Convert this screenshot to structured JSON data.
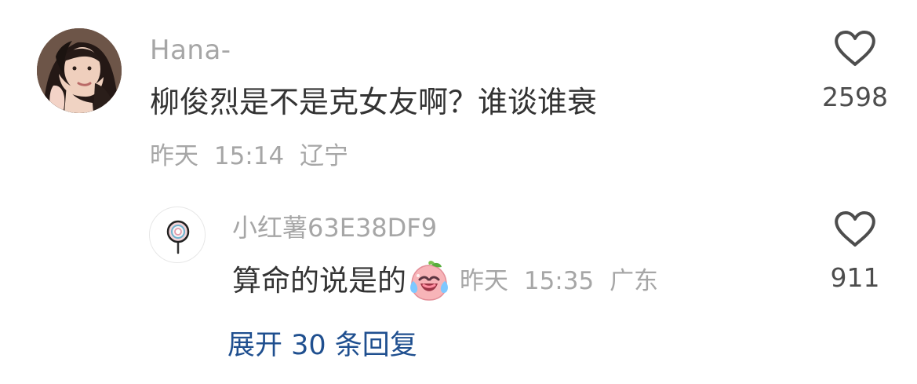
{
  "comment": {
    "username": "Hana-",
    "text": "柳俊烈是不是克女友啊？谁谈谁衰",
    "date": "昨天",
    "time": "15:14",
    "location": "辽宁",
    "likes": "2598"
  },
  "reply": {
    "username": "小红薯63E38DF9",
    "text": "算命的说是的",
    "emoji": "crying-laughing-peach-emoji",
    "date": "昨天",
    "time": "15:35",
    "location": "广东",
    "likes": "911"
  },
  "expand_label": "展开 30 条回复",
  "colors": {
    "accent": "#1f4f8f",
    "muted": "#a6a6a6",
    "text": "#333333"
  },
  "icons": {
    "like": "heart-outline-icon",
    "avatar_main": "user-photo-avatar",
    "avatar_reply": "lollipop-avatar-icon"
  }
}
